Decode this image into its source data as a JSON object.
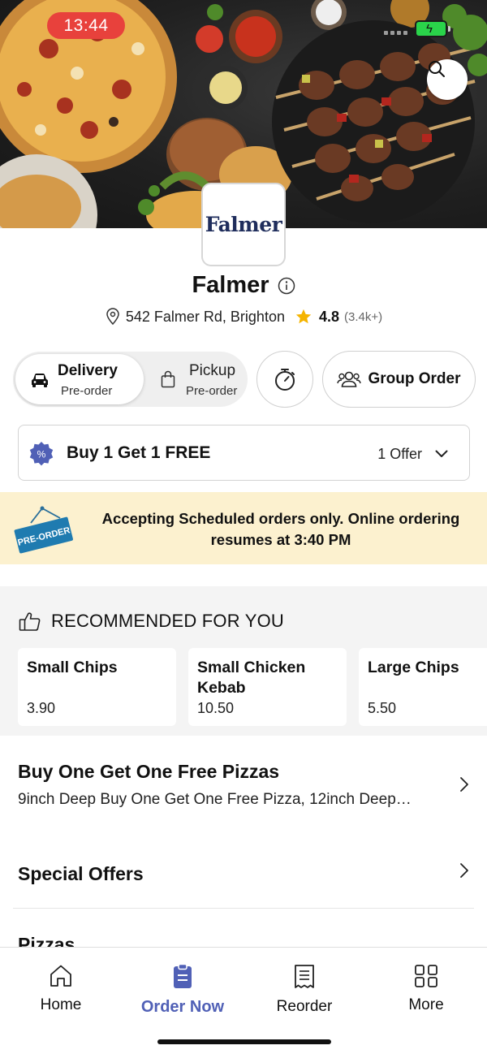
{
  "status_bar": {
    "time": "13:44"
  },
  "store": {
    "logo_text": "Falmer",
    "name": "Falmer",
    "address": "542 Falmer Rd, Brighton",
    "rating": "4.8",
    "reviews": "(3.4k+)"
  },
  "order_modes": {
    "delivery": {
      "label": "Delivery",
      "sub": "Pre-order"
    },
    "pickup": {
      "label": "Pickup",
      "sub": "Pre-order"
    },
    "group_order": "Group Order"
  },
  "offer": {
    "title": "Buy 1 Get 1 FREE",
    "count": "1 Offer"
  },
  "banner": {
    "sign": "PRE-ORDER",
    "message": "Accepting Scheduled orders only. Online ordering resumes at 3:40 PM"
  },
  "recommended": {
    "heading": "RECOMMENDED FOR YOU",
    "items": [
      {
        "name": "Small Chips",
        "price": "3.90"
      },
      {
        "name": "Small Chicken Kebab",
        "price": "10.50"
      },
      {
        "name": "Large Chips",
        "price": "5.50"
      }
    ]
  },
  "categories": [
    {
      "title": "Buy One Get One Free Pizzas",
      "description": "9inch Deep Buy One Get One Free Pizza, 12inch Deep…"
    },
    {
      "title": "Special Offers"
    },
    {
      "title": "Pizzas"
    }
  ],
  "nav": {
    "items": [
      {
        "label": "Home",
        "icon": "home-icon"
      },
      {
        "label": "Order Now",
        "icon": "order-icon"
      },
      {
        "label": "Reorder",
        "icon": "receipt-icon"
      },
      {
        "label": "More",
        "icon": "grid-icon"
      }
    ],
    "active_color": "#5060b6"
  },
  "colors": {
    "accent": "#5060b6",
    "banner_bg": "#fcf1cf",
    "rating_star": "#f5b400",
    "time_pill": "#e8413c"
  }
}
